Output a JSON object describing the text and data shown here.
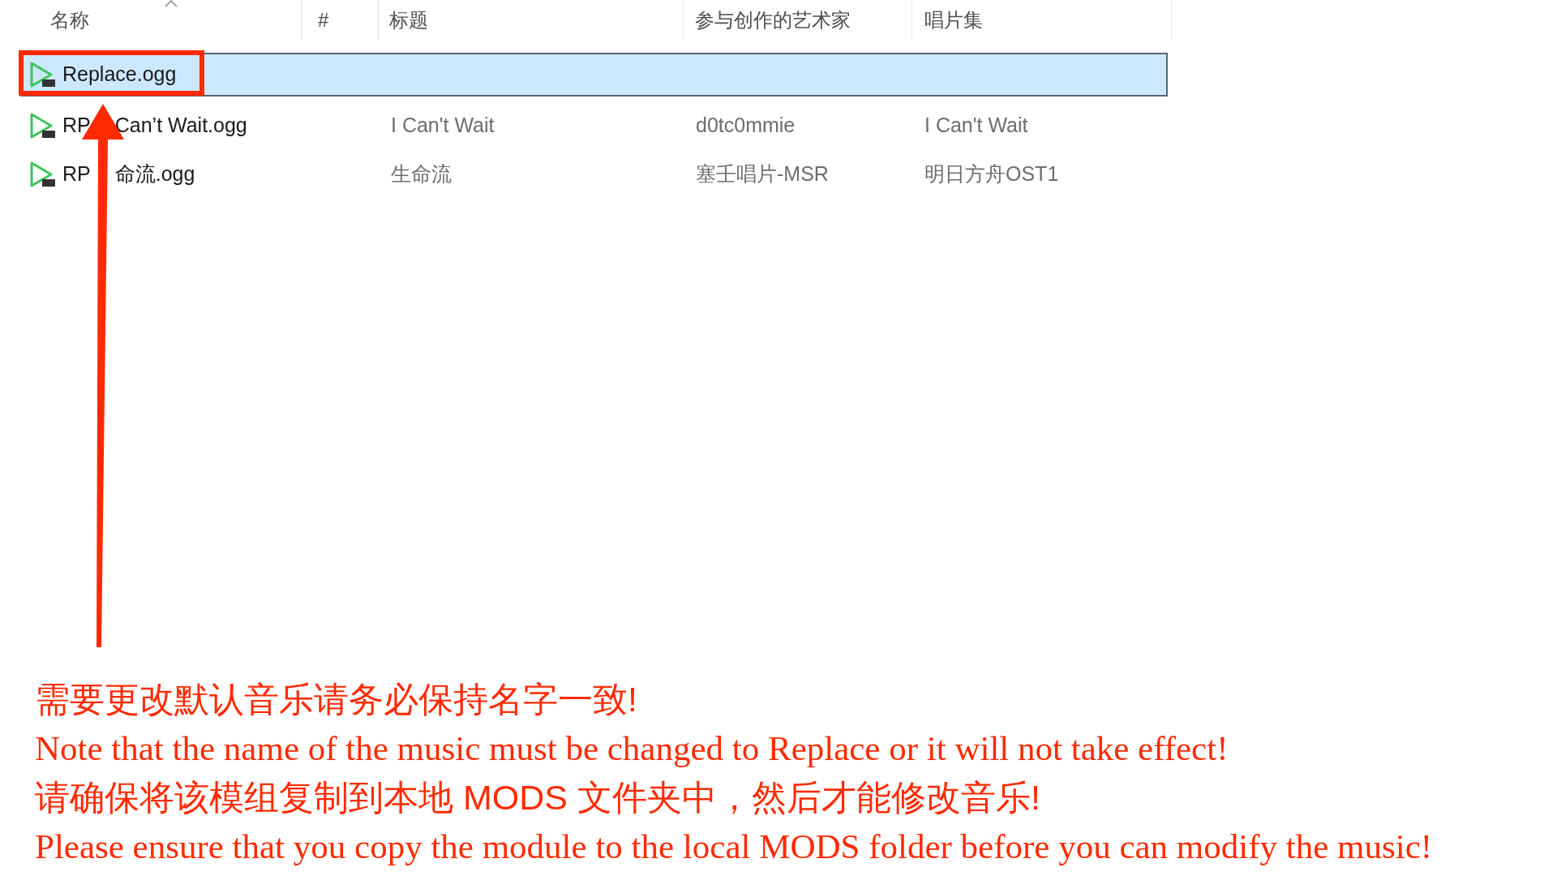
{
  "columns": [
    "名称",
    "#",
    "标题",
    "参与创作的艺术家",
    "唱片集"
  ],
  "rows": [
    {
      "name": [
        "Replace.ogg"
      ],
      "selected": true
    },
    {
      "name": [
        "RP",
        "Can’t Wait.ogg"
      ],
      "title": "I Can't Wait",
      "artist": "d0tc0mmie",
      "album": "I Can't Wait",
      "selected": false
    },
    {
      "name": [
        "RP",
        "命流.ogg"
      ],
      "title": "生命流",
      "artist": "塞壬唱片-MSR",
      "album": "明日方舟OST1",
      "selected": false
    }
  ],
  "notes": [
    {
      "kind": "zh",
      "text": "需要更改默认音乐请务必保持名字一致!"
    },
    {
      "kind": "en",
      "text": "Note that the name of the music must be changed to Replace or it will not take effect!"
    },
    {
      "kind": "zh",
      "text": "请确保将该模组复制到本地 MODS 文件夹中，然后才能修改音乐!"
    },
    {
      "kind": "en",
      "text": "Please ensure that you copy the module to the local MODS folder before you can modify the music!"
    }
  ]
}
